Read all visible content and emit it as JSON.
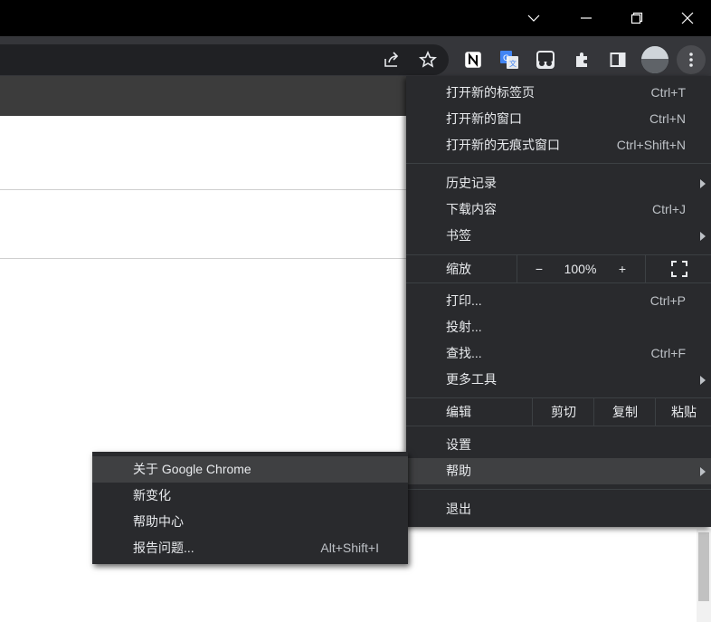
{
  "window": {
    "controls": [
      "chevron-down",
      "minimize",
      "restore",
      "close"
    ]
  },
  "toolbar": {
    "icons": [
      "share-icon",
      "bookmark-star-icon",
      "notion-extension-icon",
      "google-translate-extension-icon",
      "tampermonkey-extension-icon",
      "extensions-puzzle-icon",
      "side-panel-icon",
      "profile-avatar",
      "menu-kebab-icon"
    ]
  },
  "menu": {
    "new_tab": {
      "label": "打开新的标签页",
      "shortcut": "Ctrl+T"
    },
    "new_window": {
      "label": "打开新的窗口",
      "shortcut": "Ctrl+N"
    },
    "new_incognito": {
      "label": "打开新的无痕式窗口",
      "shortcut": "Ctrl+Shift+N"
    },
    "history": {
      "label": "历史记录"
    },
    "downloads": {
      "label": "下载内容",
      "shortcut": "Ctrl+J"
    },
    "bookmarks": {
      "label": "书签"
    },
    "zoom": {
      "label": "缩放",
      "minus": "−",
      "level": "100%",
      "plus": "+"
    },
    "print": {
      "label": "打印...",
      "shortcut": "Ctrl+P"
    },
    "cast": {
      "label": "投射..."
    },
    "find": {
      "label": "查找...",
      "shortcut": "Ctrl+F"
    },
    "more_tools": {
      "label": "更多工具"
    },
    "edit": {
      "label": "编辑",
      "cut": "剪切",
      "copy": "复制",
      "paste": "粘贴"
    },
    "settings": {
      "label": "设置"
    },
    "help": {
      "label": "帮助"
    },
    "exit": {
      "label": "退出"
    }
  },
  "help_submenu": {
    "about": {
      "label": "关于 Google Chrome"
    },
    "whats_new": {
      "label": "新变化"
    },
    "help_center": {
      "label": "帮助中心"
    },
    "report_issue": {
      "label": "报告问题...",
      "shortcut": "Alt+Shift+I"
    }
  },
  "colors": {
    "menu_bg": "#292a2d",
    "menu_highlight": "#3f4042",
    "menu_text": "#e8eaed",
    "toolbar_bg": "#35363a",
    "titlebar_bg": "#000000"
  }
}
